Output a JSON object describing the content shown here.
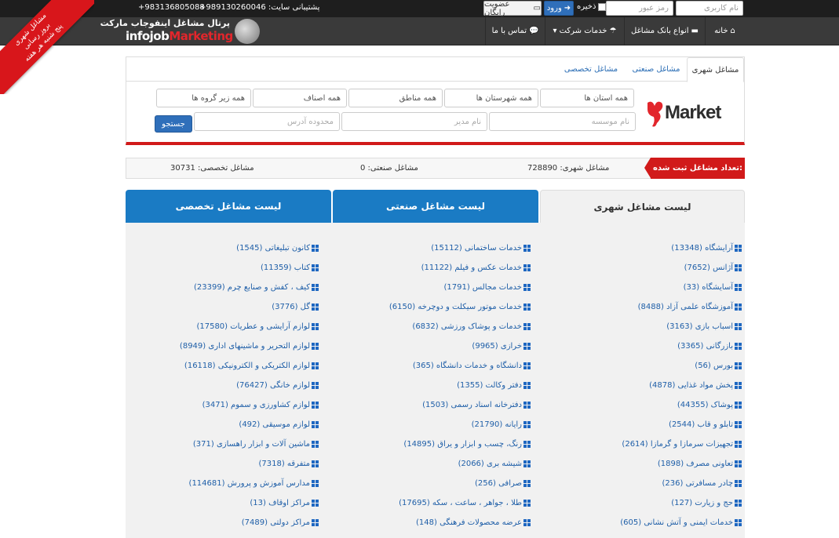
{
  "ribbon": {
    "line1": "مشاغل شهری",
    "line2": "بروز رسانی",
    "line3": "پنج شنبه هر هفته"
  },
  "topbar": {
    "phone_label": "+983136805088",
    "support_label": "+989130260046 :پشتیبانی سایت",
    "register_label": "عضویت رایگان",
    "login_label": "ورود",
    "remember_label": "ذخیره",
    "password_placeholder": "رمز عبور",
    "username_placeholder": "نام کاربری"
  },
  "logo": {
    "title": "پرتال مشاغل اینفوجاب مارکت",
    "brand_main": "infojob",
    "brand_accent": "Marketing"
  },
  "nav": {
    "home": "خانه",
    "bank_types": "انواع بانک مشاغل",
    "company_services": "خدمات شرکت",
    "contact": "تماس با ما"
  },
  "search": {
    "tabs": [
      "مشاغل شهری",
      "مشاغل صنعتی",
      "مشاغل تخصصی"
    ],
    "province": "همه استان ها",
    "city": "همه شهرستان ها",
    "region": "همه مناطق",
    "guild": "همه اصناف",
    "subgroup": "همه زیر گروه ها",
    "institution_placeholder": "نام موسسه",
    "manager_placeholder": "نام مدیر",
    "address_placeholder": "محدوده آدرس",
    "submit": "جستجو",
    "market_logo": "Market"
  },
  "stats": {
    "badge": "تعداد مشاغل ثبت شده:",
    "urban": "مشاغل شهری: 728890",
    "industrial": "مشاغل صنعتی: 0",
    "specialized": "مشاغل تخصصی: 30731"
  },
  "list_tabs": {
    "urban": "لیست مشاغل شهری",
    "industrial": "لیست مشاغل صنعتی",
    "specialized": "لیست مشاغل تخصصی"
  },
  "lists": {
    "col1": [
      "آرایشگاه (13348)",
      "آژانس (7652)",
      "آسایشگاه (33)",
      "آموزشگاه علمی آزاد (8488)",
      "اسباب بازی (3163)",
      "بازرگانی (3365)",
      "بورس (56)",
      "پخش مواد غذایی (4878)",
      "پوشاک (44355)",
      "تابلو و قاب (2544)",
      "تجهیزات سرمازا و گرمازا (2614)",
      "تعاونی مصرف (1898)",
      "چادر مسافرتی (236)",
      "حج و زیارت (127)",
      "خدمات ایمنی و آتش نشانی (605)"
    ],
    "col2": [
      "خدمات ساختمانی (15112)",
      "خدمات عکس و فیلم (11122)",
      "خدمات مجالس (1791)",
      "خدمات موتور سیکلت و دوچرخه (6150)",
      "خدمات و پوشاک ورزشی (6832)",
      "خرازی (9965)",
      "دانشگاه و خدمات دانشگاه (365)",
      "دفتر وکالت (1355)",
      "دفترخانه اسناد رسمی (1503)",
      "رایانه (21790)",
      "رنگ، چسب و ابزار و یراق (14895)",
      "شیشه بری (2066)",
      "صرافی (256)",
      "طلا ، جواهر ، ساعت ، سکه (17695)",
      "عرضه محصولات فرهنگی (148)"
    ],
    "col3": [
      "کانون تبلیغاتی (1545)",
      "کتاب (11359)",
      "کیف ، کفش و صنایع چرم (23399)",
      "گل (3776)",
      "لوازم آرایشی و عطریات (17580)",
      "لوازم التحریر و ماشینهای اداری (8949)",
      "لوازم الکتریکی و الکترونیکی (16118)",
      "لوازم خانگی (76427)",
      "لوازم کشاورزی و سموم (3471)",
      "لوازم موسیقی (492)",
      "ماشین آلات و ابزار راهسازی (371)",
      "متفرقه (7318)",
      "مدارس آموزش و پرورش (114681)",
      "مراکز اوقاف (13)",
      "مراکز دولتی (7489)"
    ]
  },
  "colors": {
    "accent": "#d11a1a",
    "tab_blue": "#1a7bc4",
    "link": "#1f5fa8",
    "nav_bg": "#3a3a3a"
  }
}
